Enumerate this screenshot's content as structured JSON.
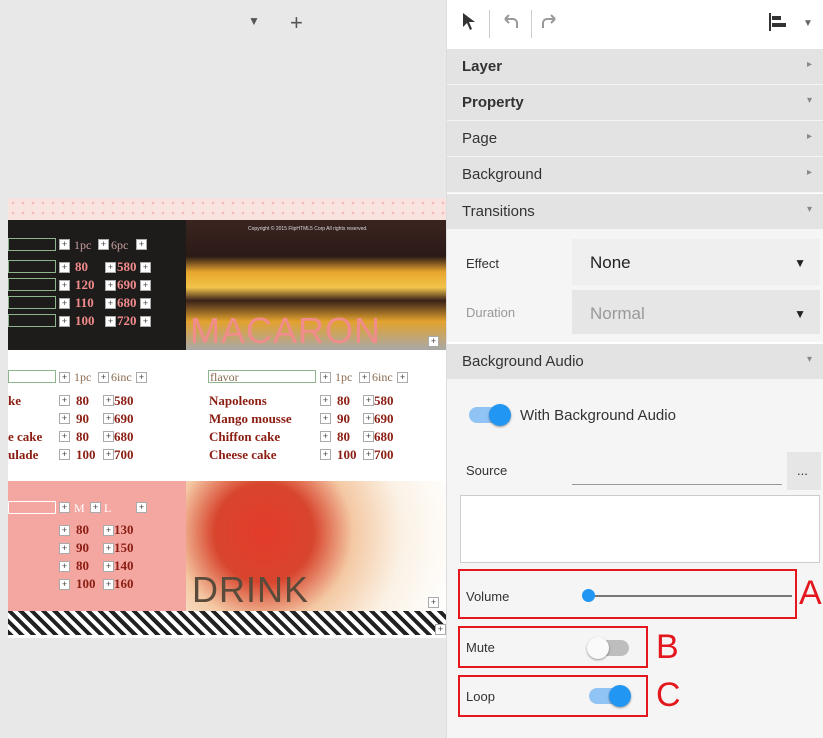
{
  "panel": {
    "sections": {
      "layer": "Layer",
      "property": "Property",
      "page": "Page",
      "background": "Background",
      "transitions": "Transitions",
      "background_audio": "Background Audio"
    },
    "transitions": {
      "effect_label": "Effect",
      "effect_value": "None",
      "duration_label": "Duration",
      "duration_value": "Normal"
    },
    "audio": {
      "with_bg_audio_label": "With Background Audio",
      "with_bg_audio_on": true,
      "source_label": "Source",
      "browse_label": "...",
      "volume_label": "Volume",
      "volume_level": 0,
      "mute_label": "Mute",
      "mute_on": false,
      "loop_label": "Loop",
      "loop_on": true
    },
    "markers": {
      "a": "A",
      "b": "B",
      "c": "C"
    }
  },
  "canvas": {
    "macaron_title": "MACARON",
    "macaron_copyright": "Copyright © 2015 FlipHTML5 Corp All rights reserved.",
    "drink_title": "DRINK",
    "dark_header": [
      "1pc",
      "6pc"
    ],
    "dark_rows": [
      [
        "80",
        "580"
      ],
      [
        "120",
        "690"
      ],
      [
        "110",
        "680"
      ],
      [
        "100",
        "720"
      ]
    ],
    "mid_left_header": [
      "1pc",
      "6inc"
    ],
    "mid_left_rows": [
      [
        "ke",
        "80",
        "580"
      ],
      [
        "",
        "90",
        "690"
      ],
      [
        "e cake",
        "80",
        "680"
      ],
      [
        "ulade",
        "100",
        "700"
      ]
    ],
    "mid_right_header": [
      "flavor",
      "1pc",
      "6inc"
    ],
    "mid_right_rows": [
      [
        "Napoleons",
        "80",
        "580"
      ],
      [
        "Mango mousse",
        "90",
        "690"
      ],
      [
        "Chiffon cake",
        "80",
        "680"
      ],
      [
        "Cheese cake",
        "100",
        "700"
      ]
    ],
    "pink_header": [
      "M",
      "L"
    ],
    "pink_rows": [
      [
        "80",
        "130"
      ],
      [
        "90",
        "150"
      ],
      [
        "80",
        "140"
      ],
      [
        "100",
        "160"
      ]
    ]
  },
  "colors": {
    "accent": "#2196f3",
    "marker": "#e3171d",
    "macaron_title": "#f08c8c",
    "drink_title": "#5a4a3a"
  }
}
